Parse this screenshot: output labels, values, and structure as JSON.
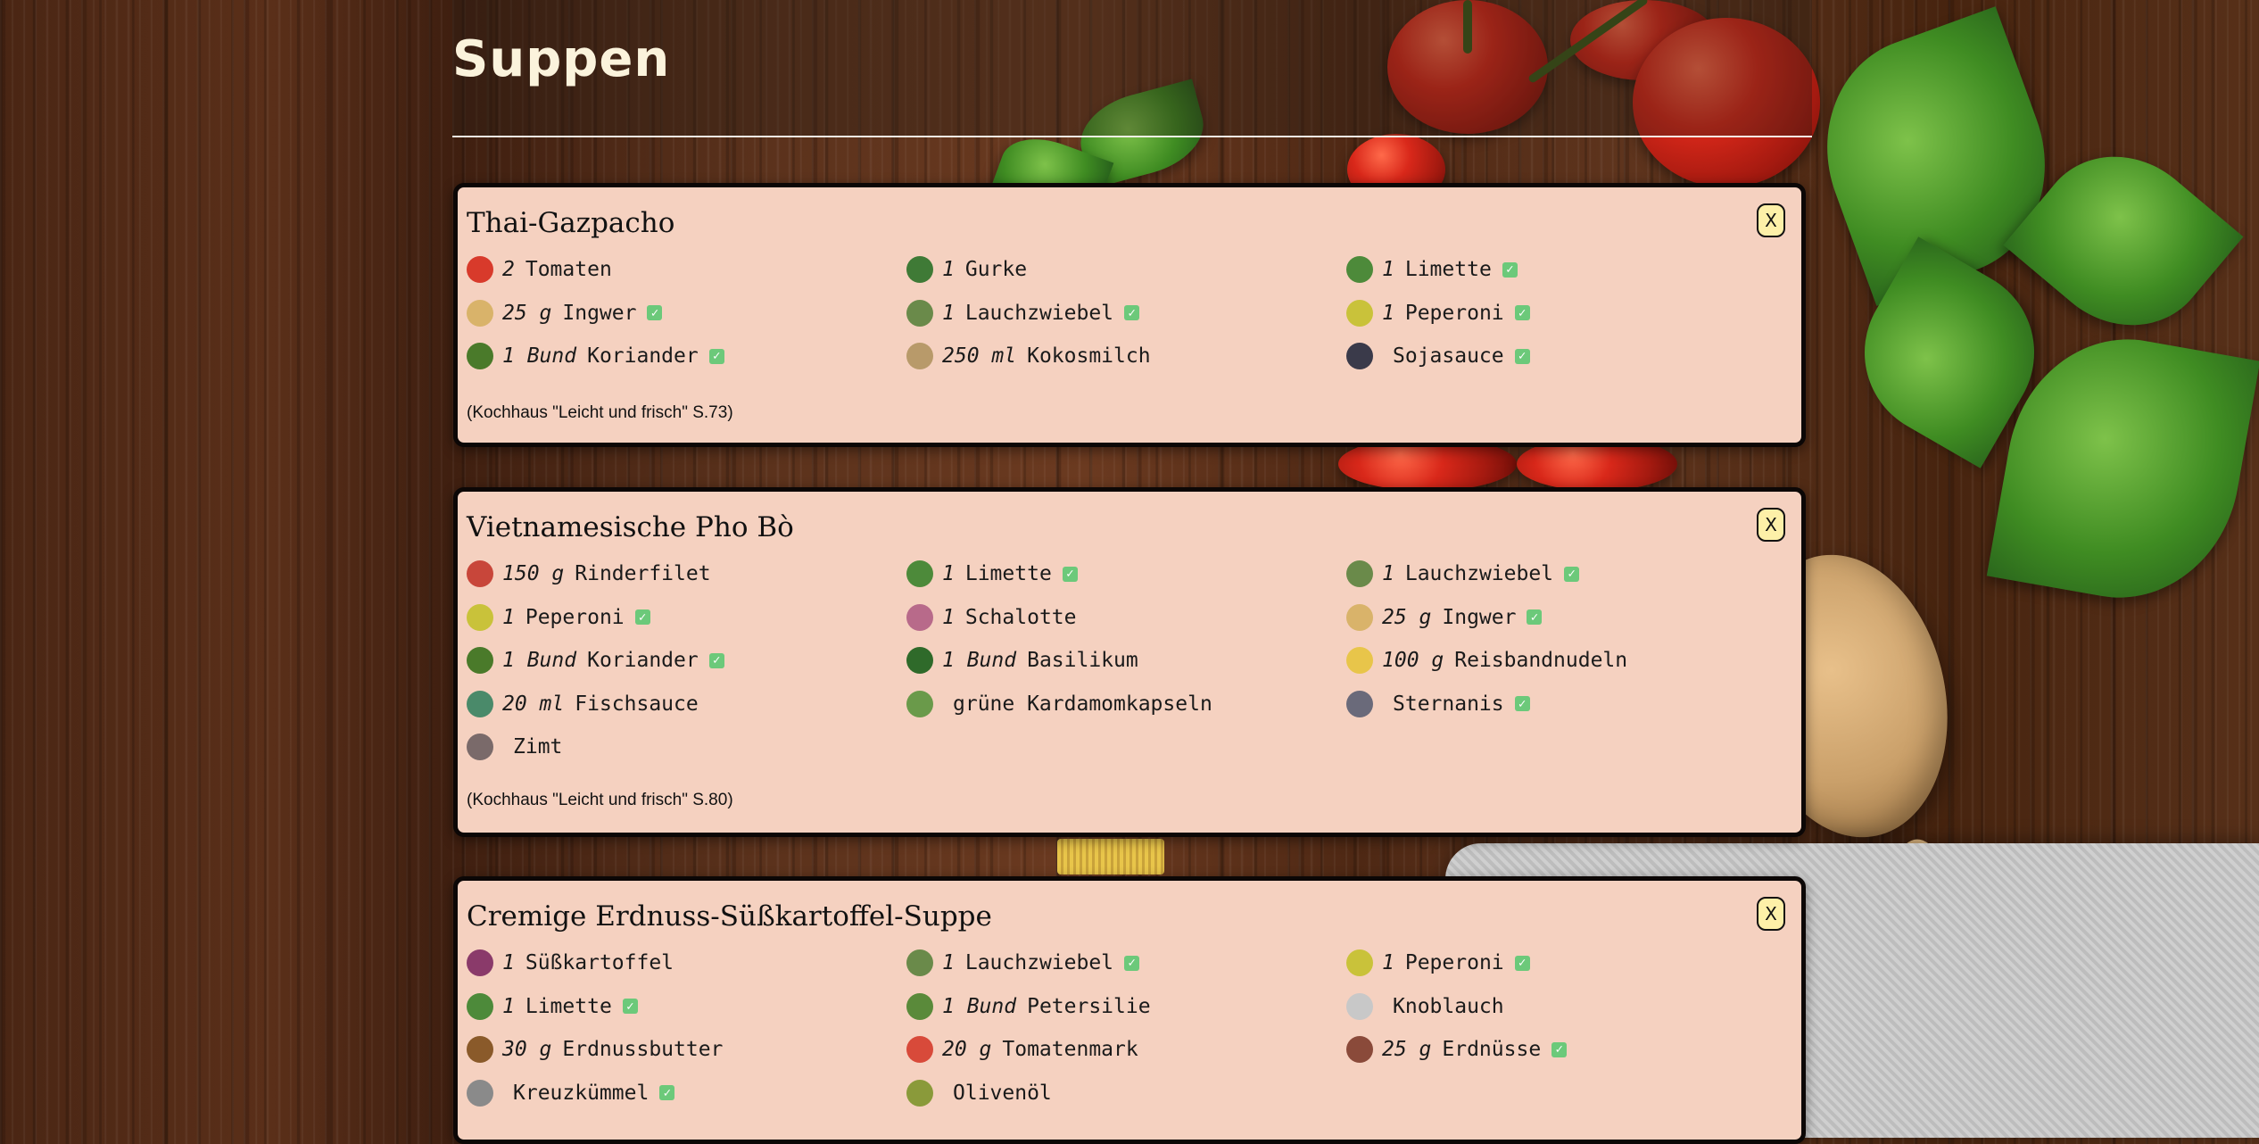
{
  "page": {
    "title": "Suppen"
  },
  "recipes": [
    {
      "title": "Thai-Gazpacho",
      "close_label": "X",
      "source": "(Kochhaus \"Leicht und frisch\" S.73)",
      "ingredients": [
        {
          "icon": "tomato-icon",
          "amount": "2",
          "name": "Tomaten",
          "available": false
        },
        {
          "icon": "cucumber-icon",
          "amount": "1",
          "name": "Gurke",
          "available": false
        },
        {
          "icon": "lime-icon",
          "amount": "1",
          "name": "Limette",
          "available": true
        },
        {
          "icon": "ginger-icon",
          "amount": "25 g",
          "name": "Ingwer",
          "available": true
        },
        {
          "icon": "spring-onion-icon",
          "amount": "1",
          "name": "Lauchzwiebel",
          "available": true
        },
        {
          "icon": "pepper-icon",
          "amount": "1",
          "name": "Peperoni",
          "available": true
        },
        {
          "icon": "coriander-icon",
          "amount": "1 Bund",
          "name": "Koriander",
          "available": true
        },
        {
          "icon": "coconut-milk-icon",
          "amount": "250 ml",
          "name": "Kokosmilch",
          "available": false
        },
        {
          "icon": "soy-sauce-icon",
          "amount": "",
          "name": "Sojasauce",
          "available": true
        }
      ]
    },
    {
      "title": "Vietnamesische Pho Bò",
      "close_label": "X",
      "source": "(Kochhaus \"Leicht und frisch\" S.80)",
      "ingredients": [
        {
          "icon": "beef-icon",
          "amount": "150 g",
          "name": "Rinderfilet",
          "available": false
        },
        {
          "icon": "lime-icon",
          "amount": "1",
          "name": "Limette",
          "available": true
        },
        {
          "icon": "spring-onion-icon",
          "amount": "1",
          "name": "Lauchzwiebel",
          "available": true
        },
        {
          "icon": "pepper-icon",
          "amount": "1",
          "name": "Peperoni",
          "available": true
        },
        {
          "icon": "shallot-icon",
          "amount": "1",
          "name": "Schalotte",
          "available": false
        },
        {
          "icon": "ginger-icon",
          "amount": "25 g",
          "name": "Ingwer",
          "available": true
        },
        {
          "icon": "coriander-icon",
          "amount": "1 Bund",
          "name": "Koriander",
          "available": true
        },
        {
          "icon": "basil-icon",
          "amount": "1 Bund",
          "name": "Basilikum",
          "available": false
        },
        {
          "icon": "rice-noodles-icon",
          "amount": "100 g",
          "name": "Reisbandnudeln",
          "available": false
        },
        {
          "icon": "fish-sauce-icon",
          "amount": "20 ml",
          "name": "Fischsauce",
          "available": false
        },
        {
          "icon": "cardamom-icon",
          "amount": "",
          "name": "grüne Kardamomkapseln",
          "available": false
        },
        {
          "icon": "star-anise-icon",
          "amount": "",
          "name": "Sternanis",
          "available": true
        },
        {
          "icon": "cinnamon-icon",
          "amount": "",
          "name": "Zimt",
          "available": false
        }
      ]
    },
    {
      "title": "Cremige Erdnuss-Süßkartoffel-Suppe",
      "close_label": "X",
      "source": "",
      "ingredients": [
        {
          "icon": "sweet-potato-icon",
          "amount": "1",
          "name": "Süßkartoffel",
          "available": false
        },
        {
          "icon": "spring-onion-icon",
          "amount": "1",
          "name": "Lauchzwiebel",
          "available": true
        },
        {
          "icon": "pepper-icon",
          "amount": "1",
          "name": "Peperoni",
          "available": true
        },
        {
          "icon": "lime-icon",
          "amount": "1",
          "name": "Limette",
          "available": true
        },
        {
          "icon": "parsley-icon",
          "amount": "1 Bund",
          "name": "Petersilie",
          "available": false
        },
        {
          "icon": "garlic-icon",
          "amount": "",
          "name": "Knoblauch",
          "available": false
        },
        {
          "icon": "peanut-butter-icon",
          "amount": "30 g",
          "name": "Erdnussbutter",
          "available": false
        },
        {
          "icon": "tomato-paste-icon",
          "amount": "20 g",
          "name": "Tomatenmark",
          "available": false
        },
        {
          "icon": "peanuts-icon",
          "amount": "25 g",
          "name": "Erdnüsse",
          "available": true
        },
        {
          "icon": "cumin-icon",
          "amount": "",
          "name": "Kreuzkümmel",
          "available": true
        },
        {
          "icon": "olive-oil-icon",
          "amount": "",
          "name": "Olivenöl",
          "available": false
        }
      ]
    }
  ],
  "icon_colors": {
    "tomato-icon": "#d83a2b",
    "cucumber-icon": "#3f7a36",
    "lime-icon": "#4d8a3a",
    "ginger-icon": "#d9b36a",
    "spring-onion-icon": "#6a8a4a",
    "pepper-icon": "#c9c23a",
    "coriander-icon": "#4a7a2a",
    "coconut-milk-icon": "#b89a6a",
    "soy-sauce-icon": "#3a3a4a",
    "beef-icon": "#c8463a",
    "shallot-icon": "#b86a8a",
    "basil-icon": "#2f6a2a",
    "rice-noodles-icon": "#e8c54a",
    "fish-sauce-icon": "#4a8a6a",
    "cardamom-icon": "#6a9a4a",
    "star-anise-icon": "#6a6a7a",
    "cinnamon-icon": "#7a6a6a",
    "sweet-potato-icon": "#8a3a6a",
    "parsley-icon": "#5a8a3a",
    "garlic-icon": "#c8c8c8",
    "peanut-butter-icon": "#8a5a2a",
    "tomato-paste-icon": "#d84a3a",
    "peanuts-icon": "#8a4a3a",
    "cumin-icon": "#8a8a8a",
    "olive-oil-icon": "#8a9a3a"
  },
  "check_color": "#6cc97a",
  "card_color": "#f5d1c0"
}
